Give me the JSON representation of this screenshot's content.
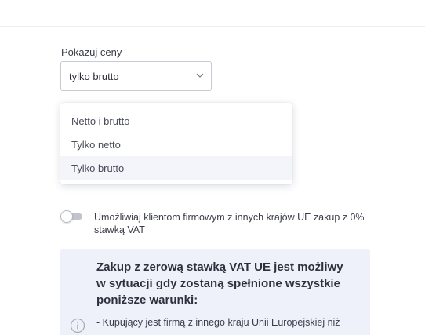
{
  "price_display": {
    "label": "Pokazuj ceny",
    "selected_value": "tylko brutto",
    "options": [
      {
        "label": "Netto i brutto"
      },
      {
        "label": "Tylko netto"
      },
      {
        "label": "Tylko brutto",
        "selected": true
      }
    ]
  },
  "eu_zero_vat": {
    "toggle_label": "Umożliwiaj klientom firmowym z innych krajów UE zakup z 0% stawką VAT",
    "enabled": false
  },
  "info_box": {
    "title": "Zakup z zerową stawką VAT UE jest możliwy w sytuacji gdy zostaną spełnione wszystkie poniższe warunki:",
    "condition_1": "- Kupujący jest firmą z innego kraju Unii Europejskiej niż"
  },
  "colors": {
    "accent": "#3b4fd0",
    "info_bg": "#eff1fa",
    "selected_option_bg": "#f3f5fb"
  }
}
